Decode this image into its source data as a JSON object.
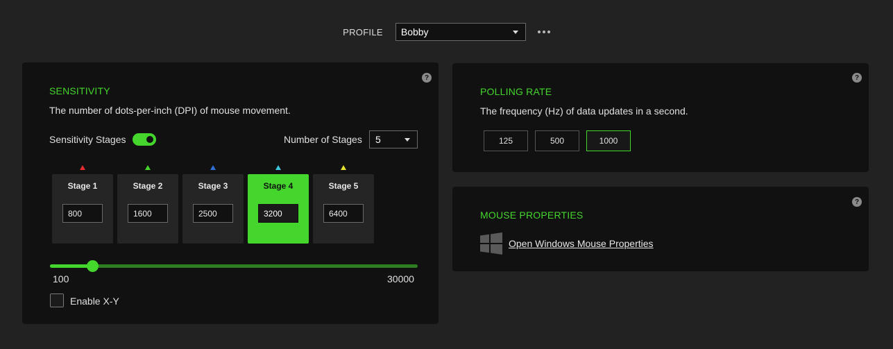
{
  "profile": {
    "label": "PROFILE",
    "selected": "Bobby"
  },
  "sensitivity": {
    "title": "SENSITIVITY",
    "description": "The number of dots-per-inch (DPI) of mouse movement.",
    "stages_toggle_label": "Sensitivity Stages",
    "stages_toggle_on": true,
    "number_of_stages_label": "Number of Stages",
    "number_of_stages_value": "5",
    "stages": [
      {
        "name": "Stage 1",
        "value": "800",
        "color": "#e82c2c",
        "active": false
      },
      {
        "name": "Stage 2",
        "value": "1600",
        "color": "#44d62c",
        "active": false
      },
      {
        "name": "Stage 3",
        "value": "2500",
        "color": "#2f6fd6",
        "active": false
      },
      {
        "name": "Stage 4",
        "value": "3200",
        "color": "#3ec6e0",
        "active": true
      },
      {
        "name": "Stage 5",
        "value": "6400",
        "color": "#e8e22c",
        "active": false
      }
    ],
    "slider": {
      "min": "100",
      "max": "30000"
    },
    "enable_xy_label": "Enable X-Y",
    "enable_xy_checked": false
  },
  "polling_rate": {
    "title": "POLLING RATE",
    "description": "The frequency (Hz) of data updates in a second.",
    "options": [
      {
        "label": "125",
        "active": false
      },
      {
        "label": "500",
        "active": false
      },
      {
        "label": "1000",
        "active": true
      }
    ]
  },
  "mouse_properties": {
    "title": "MOUSE PROPERTIES",
    "link_label": "Open Windows Mouse Properties"
  },
  "help_icon_glyph": "?",
  "colors": {
    "accent": "#44d62c",
    "background": "#222222",
    "panel": "#111111"
  }
}
